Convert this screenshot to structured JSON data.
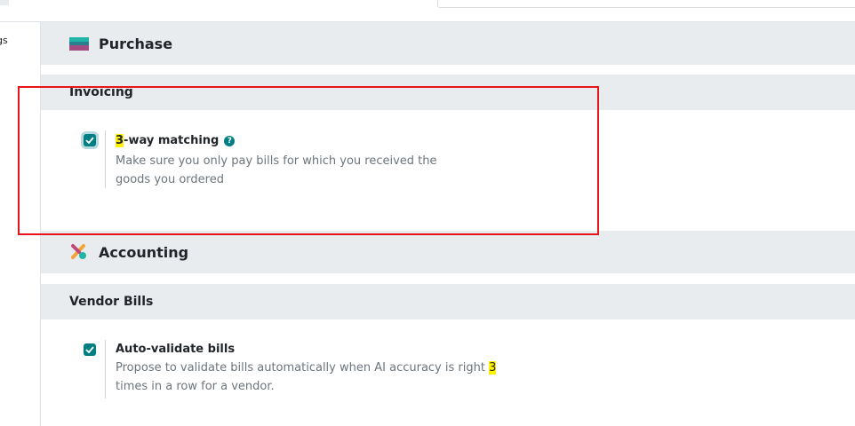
{
  "sidebar": {
    "items": [
      {
        "label": "gs"
      },
      {
        "label": "l"
      }
    ]
  },
  "apps": [
    {
      "title": "Purchase",
      "icon": "purchase-app-icon",
      "section": "Invoicing",
      "setting": {
        "label_highlight": "3",
        "label_rest": "-way matching",
        "help_icon": "question-circle-icon",
        "description": "Make sure you only pay bills for which you received the goods you ordered",
        "checked": true
      }
    },
    {
      "title": "Accounting",
      "icon": "accounting-app-icon",
      "section": "Vendor Bills",
      "setting": {
        "label": "Auto-validate bills",
        "description_line1": "Propose to validate bills automatically when AI accuracy is right",
        "description_highlight": "3",
        "description_rest": " times in a row for a vendor.",
        "checked": true
      }
    }
  ],
  "colors": {
    "accent": "#017e84",
    "highlight": "#fff200",
    "annotation": "#e8141b"
  }
}
